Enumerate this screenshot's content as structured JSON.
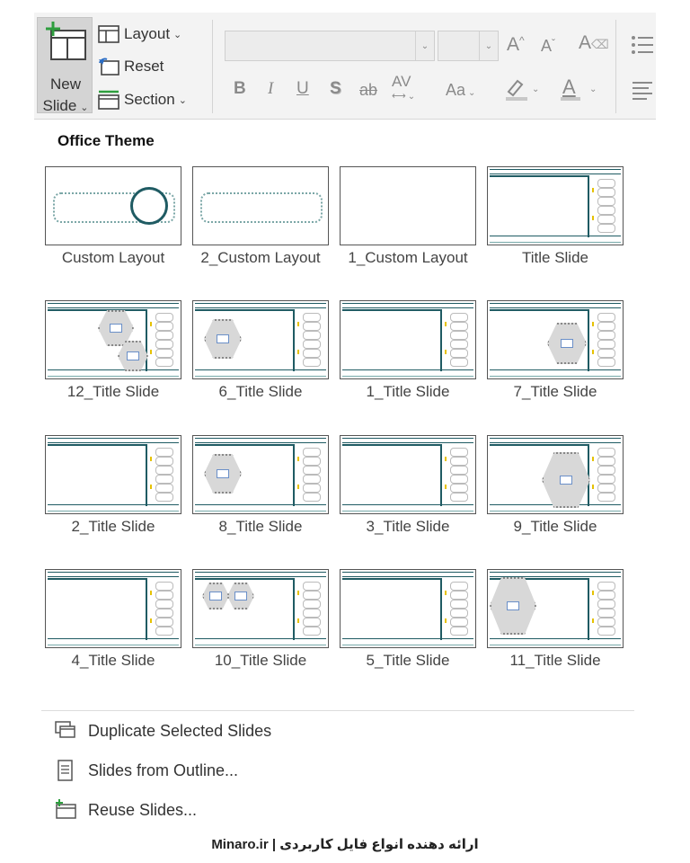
{
  "ribbon": {
    "new_slide_label_1": "New",
    "new_slide_label_2": "Slide",
    "layout_label": "Layout",
    "reset_label": "Reset",
    "section_label": "Section",
    "font_name_value": "",
    "font_size_value": ""
  },
  "gallery": {
    "theme_title": "Office Theme",
    "layouts": [
      {
        "label": "Custom Layout"
      },
      {
        "label": "2_Custom Layout"
      },
      {
        "label": "1_Custom Layout"
      },
      {
        "label": "Title Slide"
      },
      {
        "label": "12_Title Slide"
      },
      {
        "label": "6_Title Slide"
      },
      {
        "label": "1_Title Slide"
      },
      {
        "label": "7_Title Slide"
      },
      {
        "label": "2_Title Slide"
      },
      {
        "label": "8_Title Slide"
      },
      {
        "label": "3_Title Slide"
      },
      {
        "label": "9_Title Slide"
      },
      {
        "label": "4_Title Slide"
      },
      {
        "label": "10_Title Slide"
      },
      {
        "label": "5_Title Slide"
      },
      {
        "label": "11_Title Slide"
      }
    ]
  },
  "menu": {
    "duplicate": "Duplicate Selected Slides",
    "from_outline": "Slides from Outline...",
    "reuse": "Reuse Slides..."
  },
  "footer": {
    "text": "Minaro.ir | ارائه دهنده انواع فایل کاربردی"
  },
  "colors": {
    "accent_teal": "#1f5b63",
    "new_slide_green": "#2e9e3e"
  }
}
